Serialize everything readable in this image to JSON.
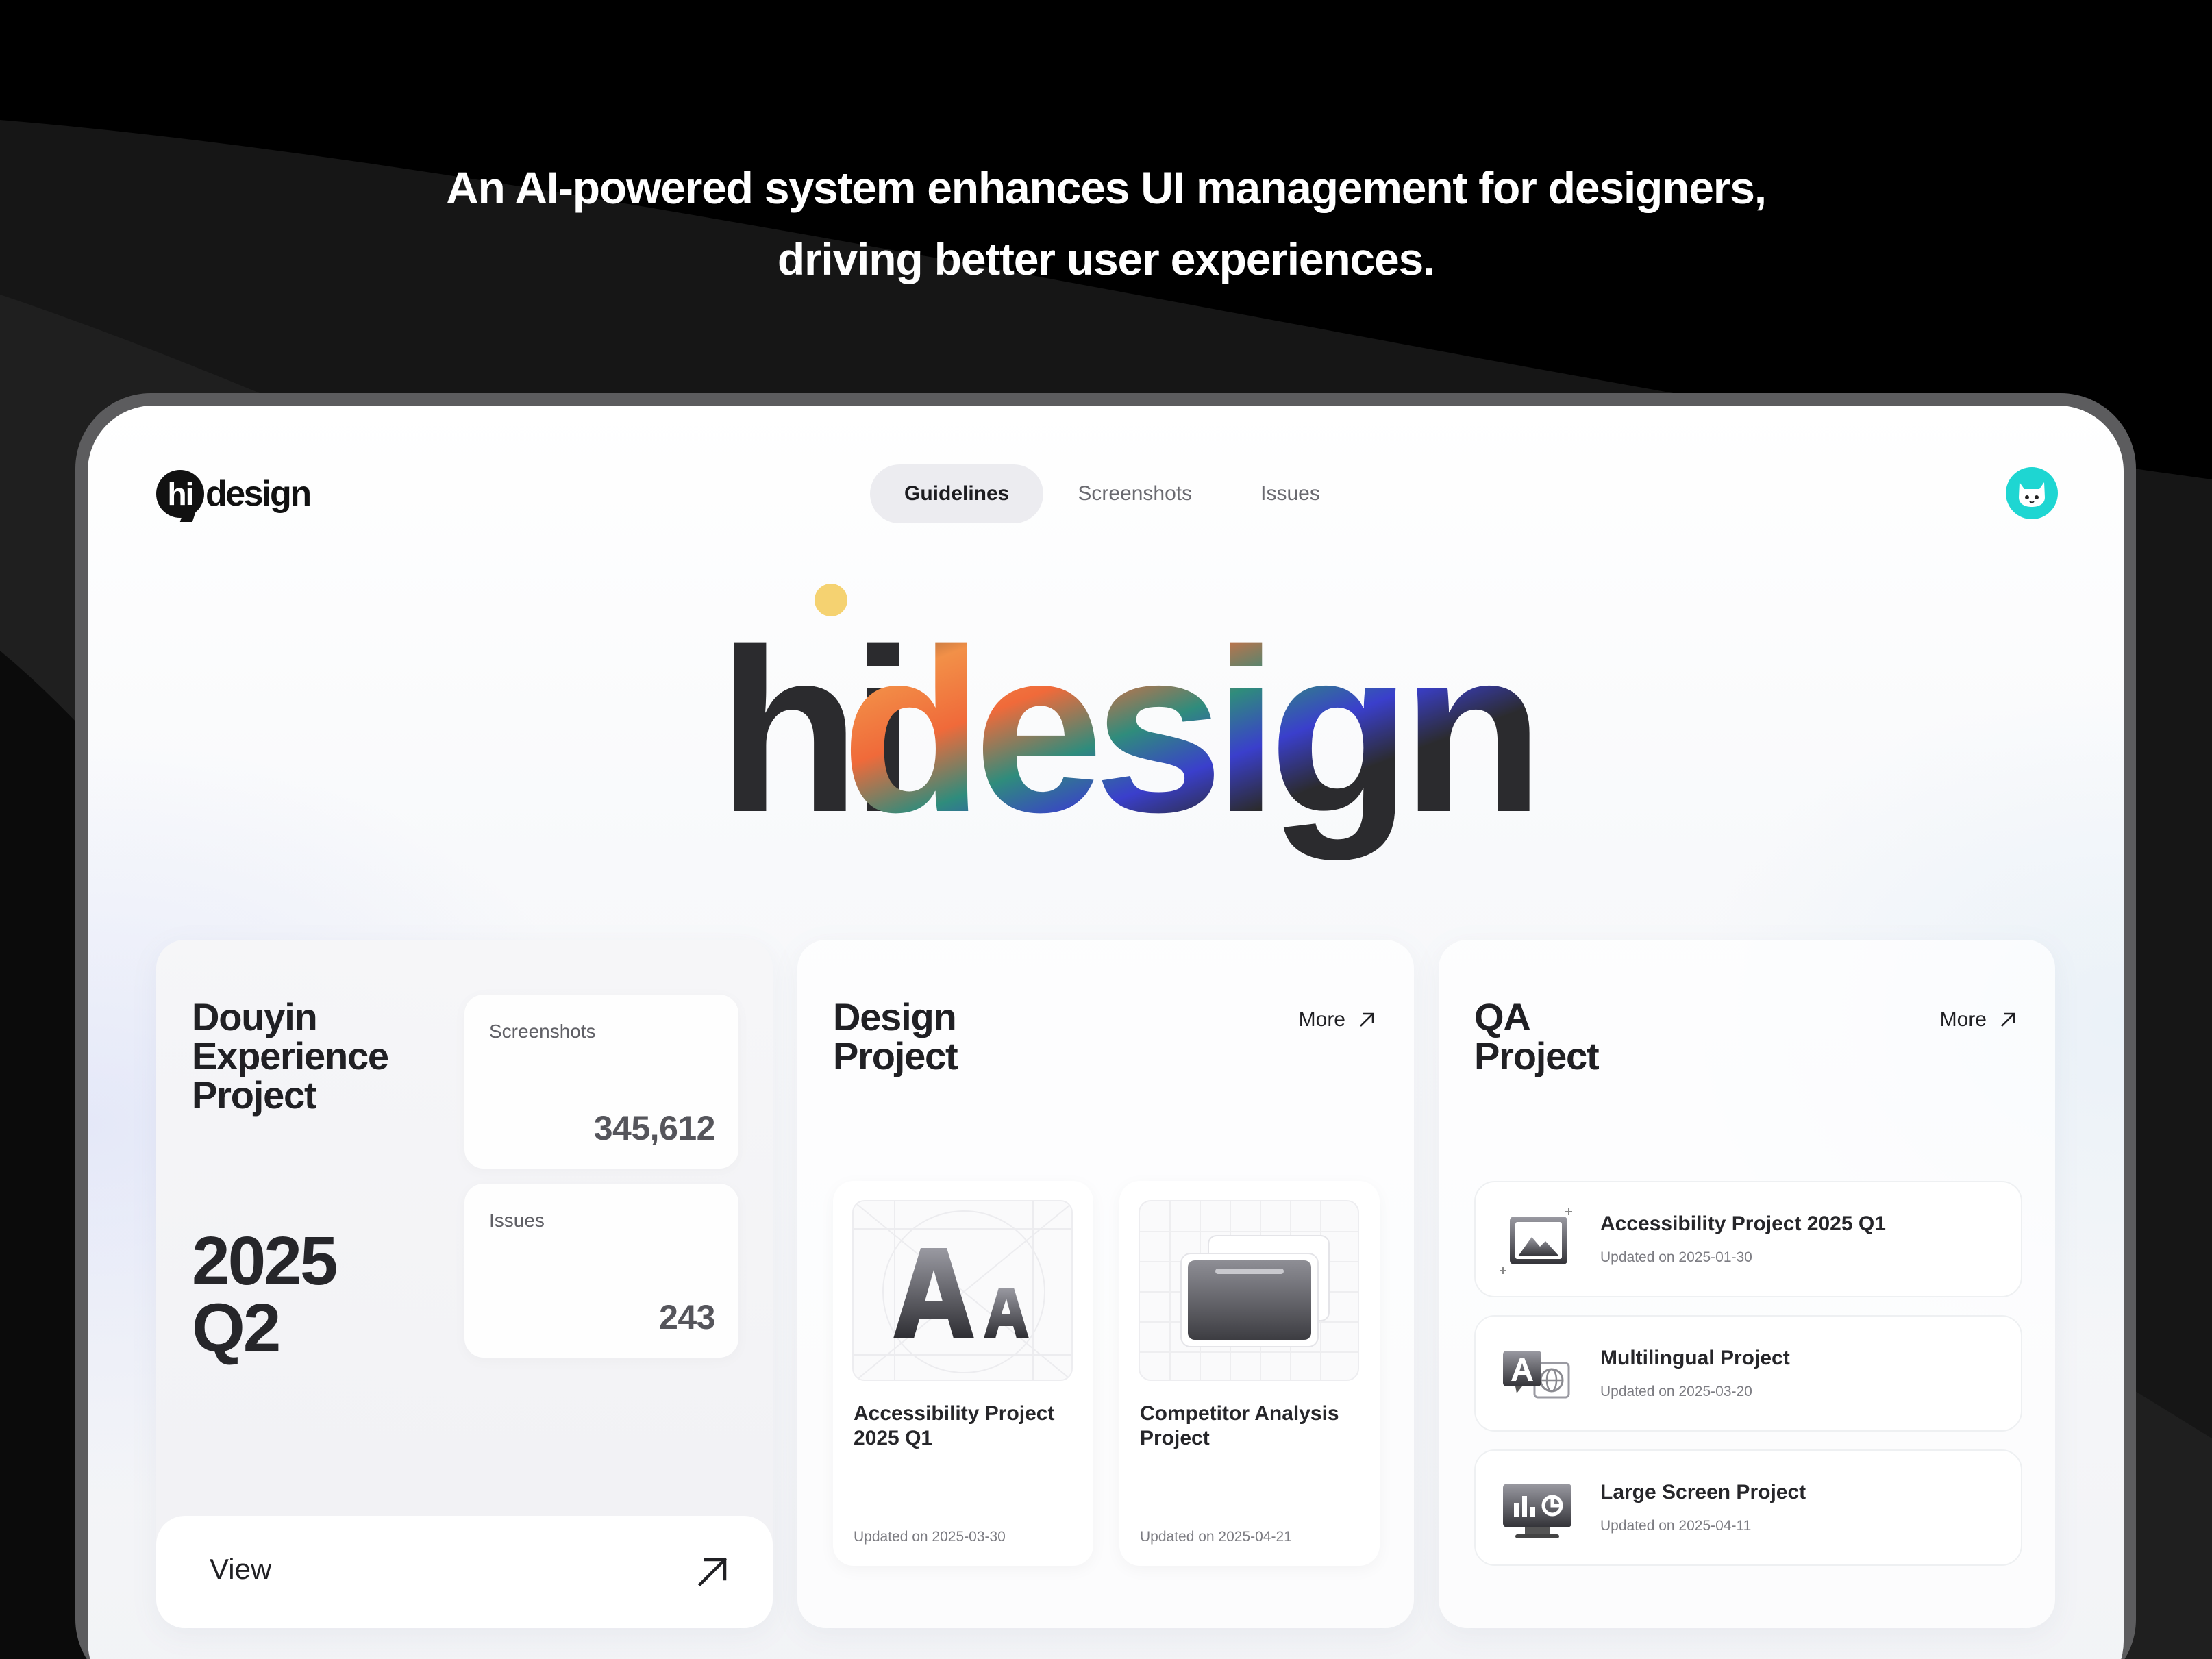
{
  "tagline": {
    "line1": "An AI-powered system enhances UI management for designers,",
    "line2": "driving better user experiences."
  },
  "brand": {
    "logo_mark": "hi",
    "logo_word": "design",
    "hero_word_1": "hi",
    "hero_word_2": "design"
  },
  "nav": {
    "items": [
      {
        "label": "Guidelines",
        "active": true
      },
      {
        "label": "Screenshots",
        "active": false
      },
      {
        "label": "Issues",
        "active": false
      }
    ]
  },
  "avatar": {
    "icon": "cat-avatar-icon",
    "color": "#1ed6d2"
  },
  "summary_card": {
    "title": "Douyin Experience Project",
    "period_year": "2025",
    "period_quarter": "Q2",
    "stats": [
      {
        "label": "Screenshots",
        "value": "345,612"
      },
      {
        "label": "Issues",
        "value": "243"
      }
    ],
    "view_label": "View"
  },
  "design_card": {
    "title_line1": "Design",
    "title_line2": "Project",
    "more_label": "More",
    "tiles": [
      {
        "name": "Accessibility Project 2025 Q1",
        "updated": "Updated on 2025-03-30",
        "icon": "typography-icon"
      },
      {
        "name": "Competitor Analysis Project",
        "updated": "Updated on 2025-04-21",
        "icon": "stacked-windows-icon"
      }
    ]
  },
  "qa_card": {
    "title_line1": "QA",
    "title_line2": "Project",
    "more_label": "More",
    "items": [
      {
        "name": "Accessibility Project 2025 Q1",
        "updated": "Updated on 2025-01-30",
        "icon": "image-icon"
      },
      {
        "name": "Multilingual Project",
        "updated": "Updated on 2025-03-20",
        "icon": "translate-icon"
      },
      {
        "name": "Large Screen Project",
        "updated": "Updated on 2025-04-11",
        "icon": "monitor-chart-icon"
      }
    ]
  },
  "colors": {
    "accent_teal": "#1ed6d2",
    "hero_yellow": "#f5d271",
    "hero_orange": "#f07a3e",
    "hero_blue": "#3b3fc8",
    "hero_red": "#e8423a",
    "text_dark": "#202024"
  }
}
